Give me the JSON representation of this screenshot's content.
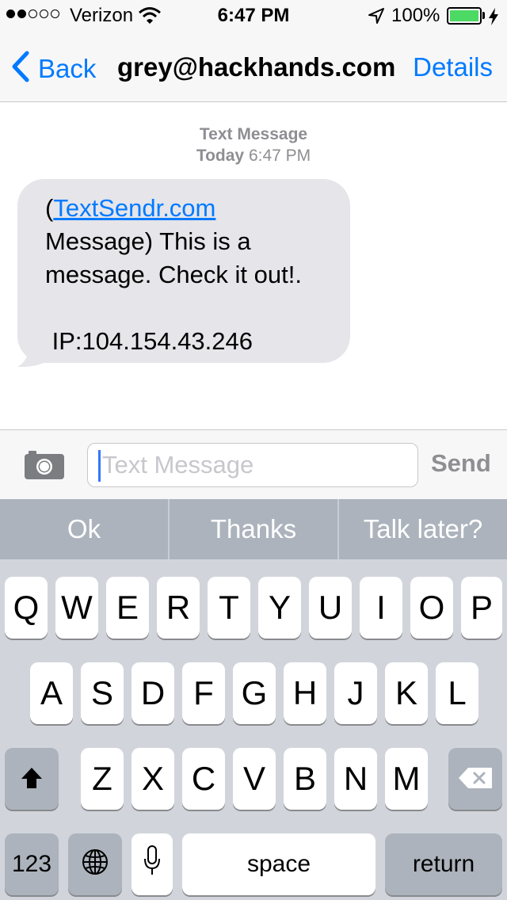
{
  "status_bar": {
    "carrier": "Verizon",
    "time": "6:47 PM",
    "battery": "100%",
    "signal_bars_filled": 2,
    "signal_bars_total": 5,
    "battery_level": 1.0,
    "battery_color": "#4cd964"
  },
  "nav": {
    "back_label": "Back",
    "title": "grey@hackhands.com",
    "details_label": "Details",
    "accent_color": "#007aff"
  },
  "conversation": {
    "header_label": "Text Message",
    "header_day": "Today",
    "header_time": "6:47 PM",
    "message": {
      "open_paren": "(",
      "link_text": "TextSendr.com",
      "line2": "Message) This is a",
      "line3": "message. Check it out!.",
      "line4": "",
      "line5": " IP:104.154.43.246"
    }
  },
  "composer": {
    "placeholder": "Text Message",
    "send_label": "Send"
  },
  "suggestions": [
    "Ok",
    "Thanks",
    "Talk later?"
  ],
  "keyboard": {
    "row1": [
      "Q",
      "W",
      "E",
      "R",
      "T",
      "Y",
      "U",
      "I",
      "O",
      "P"
    ],
    "row2": [
      "A",
      "S",
      "D",
      "F",
      "G",
      "H",
      "J",
      "K",
      "L"
    ],
    "row3": [
      "Z",
      "X",
      "C",
      "V",
      "B",
      "N",
      "M"
    ],
    "numbers_label": "123",
    "space_label": "space",
    "return_label": "return"
  },
  "icons": {
    "back": "chevron-left-icon",
    "camera": "camera-icon",
    "shift": "shift-arrow-icon",
    "delete": "backspace-icon",
    "globe": "globe-icon",
    "mic": "microphone-icon",
    "wifi": "wifi-icon",
    "location": "location-arrow-icon",
    "charging": "lightning-bolt-icon"
  }
}
